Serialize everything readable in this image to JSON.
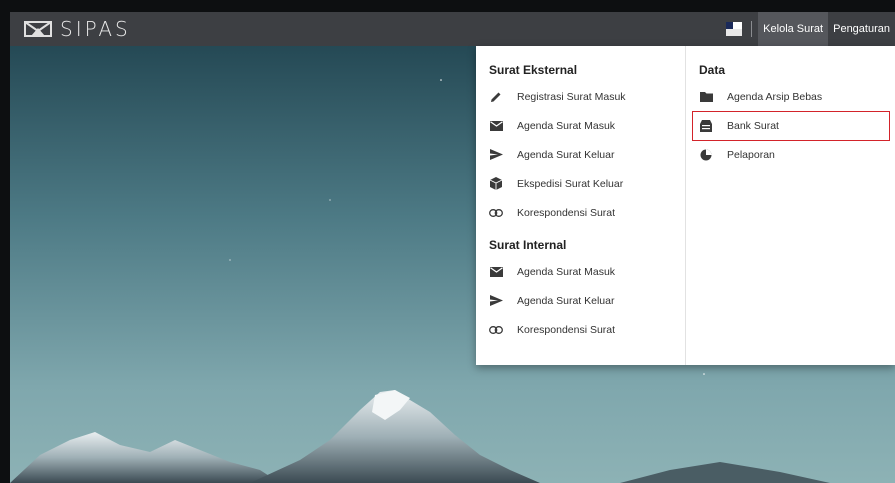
{
  "app": {
    "name": "SIPAS"
  },
  "topbar": {
    "nav_items": [
      {
        "label": "Kelola Surat",
        "active": true
      },
      {
        "label": "Pengaturan",
        "active": false
      }
    ]
  },
  "menu": {
    "left": {
      "sections": [
        {
          "title": "Surat Eksternal",
          "items": [
            {
              "label": "Registrasi Surat Masuk",
              "icon": "pencil-icon"
            },
            {
              "label": "Agenda Surat Masuk",
              "icon": "envelope-icon"
            },
            {
              "label": "Agenda Surat Keluar",
              "icon": "send-icon"
            },
            {
              "label": "Ekspedisi Surat Keluar",
              "icon": "box-icon"
            },
            {
              "label": "Korespondensi Surat",
              "icon": "link-icon"
            }
          ]
        },
        {
          "title": "Surat Internal",
          "items": [
            {
              "label": "Agenda Surat Masuk",
              "icon": "envelope-icon"
            },
            {
              "label": "Agenda Surat Keluar",
              "icon": "send-icon"
            },
            {
              "label": "Korespondensi Surat",
              "icon": "link-icon"
            }
          ]
        }
      ]
    },
    "right": {
      "title": "Data",
      "items": [
        {
          "label": "Agenda Arsip Bebas",
          "icon": "folder-icon"
        },
        {
          "label": "Bank Surat",
          "icon": "archive-icon",
          "highlighted": true
        },
        {
          "label": "Pelaporan",
          "icon": "pie-chart-icon"
        }
      ]
    }
  },
  "colors": {
    "topbar": "#3d3f43",
    "active_nav": "#55575c",
    "highlight_border": "#d3232a"
  }
}
